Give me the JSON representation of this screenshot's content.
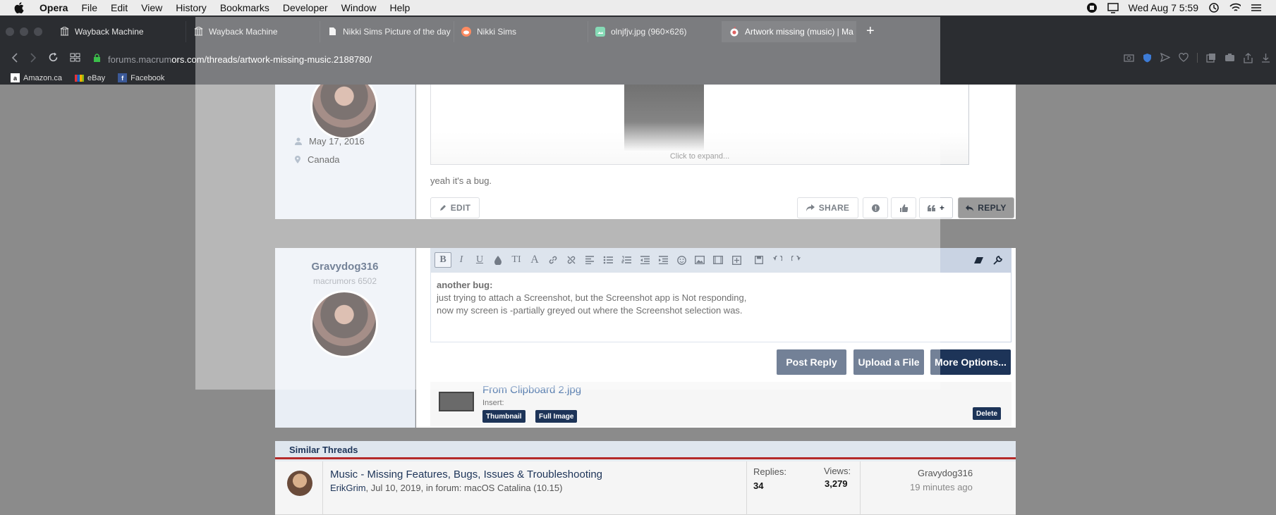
{
  "menubar": {
    "app": "Opera",
    "items": [
      "File",
      "Edit",
      "View",
      "History",
      "Bookmarks",
      "Developer",
      "Window",
      "Help"
    ],
    "clock": "Wed Aug 7  5:59"
  },
  "tabs": [
    {
      "label": "Wayback Machine",
      "icon": "archive-icon"
    },
    {
      "label": "Wayback Machine",
      "icon": "archive-icon"
    },
    {
      "label": "Nikki Sims Picture of the day",
      "icon": "document-icon"
    },
    {
      "label": "Nikki Sims",
      "icon": "reddit-icon"
    },
    {
      "label": "olnjfjv.jpg (960×626)",
      "icon": "image-icon"
    },
    {
      "label": "Artwork missing (music) | Ma",
      "icon": "macrumors-icon",
      "active": true
    }
  ],
  "address": {
    "prefix": "forums.macrum",
    "host": "ors.com",
    "path": "/threads/artwork-missing-music.2188780/"
  },
  "bookmarks": [
    {
      "label": "Amazon.ca",
      "icon": "amazon-icon"
    },
    {
      "label": "eBay",
      "icon": "ebay-icon"
    },
    {
      "label": "Facebook",
      "icon": "facebook-icon"
    }
  ],
  "post1": {
    "joined": "May 17, 2016",
    "location": "Canada",
    "expand": "Click to expand...",
    "body": "yeah it's a bug.",
    "edit": "EDIT",
    "share": "SHARE",
    "reply": "REPLY",
    "quote_plus": "+"
  },
  "reply_form": {
    "username": "Gravydog316",
    "usertitle": "macrumors 6502",
    "line1": "another bug:",
    "line2": "just trying to attach a Screenshot, but the Screenshot app is Not responding,",
    "line3": "now my screen is -partially greyed out where the Screenshot selection was.",
    "post_reply": "Post Reply",
    "upload": "Upload a File",
    "more": "More Options...",
    "attachment_name": "From Clipboard 2.jpg",
    "insert": "Insert:",
    "thumbnail": "Thumbnail",
    "full_image": "Full Image",
    "delete": "Delete"
  },
  "similar": {
    "heading": "Similar Threads",
    "thread_title": "Music - Missing Features, Bugs, Issues & Troubleshooting",
    "author": "ErikGrim",
    "meta": ", Jul 10, 2019, in forum: macOS Catalina (10.15)",
    "replies_label": "Replies:",
    "replies": "34",
    "views_label": "Views:",
    "views": "3,279",
    "last_user": "Gravydog316",
    "last_time": "19 minutes ago"
  }
}
